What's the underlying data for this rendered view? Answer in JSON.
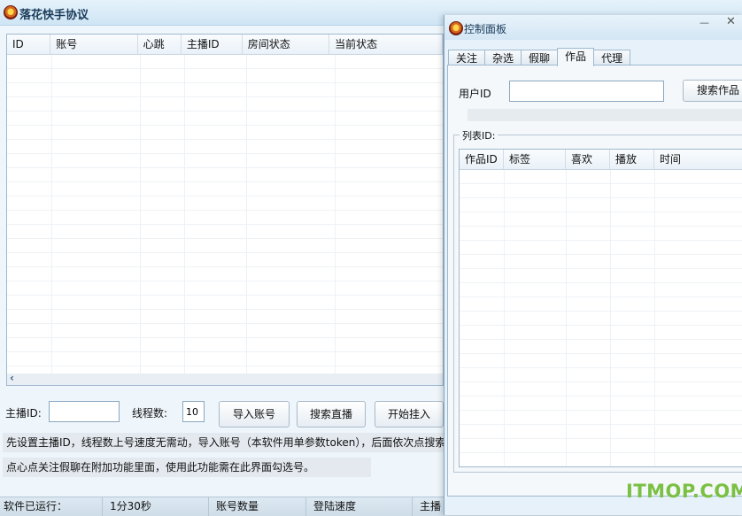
{
  "main_window": {
    "title": "落花快手协议",
    "table": {
      "columns": [
        "ID",
        "账号",
        "心跳",
        "主播ID",
        "房间状态",
        "当前状态"
      ],
      "rows": []
    },
    "anchor_id": {
      "label": "主播ID:",
      "value": ""
    },
    "threads": {
      "label": "线程数:",
      "value": "10"
    },
    "buttons": {
      "import": "导入账号",
      "search_live": "搜索直播",
      "start": "开始挂入"
    },
    "notice_line1": "先设置主播ID，线程数上号速度无需动，导入账号（本软件用单参数token），后面依次点搜索",
    "notice_line2": "点心点关注假聊在附加功能里面，使用此功能需在此界面勾选号。"
  },
  "statusbar": {
    "running_label": "软件已运行：",
    "running_value": "1分30秒",
    "account_count_label": "账号数量",
    "login_speed_label": "登陆速度",
    "anchor_label": "主播"
  },
  "control_panel": {
    "title": "控制面板",
    "tabs": [
      "关注",
      "杂选",
      "假聊",
      "作品",
      "代理"
    ],
    "active_tab": "作品",
    "user_id": {
      "label": "用户ID",
      "value": ""
    },
    "search_button": "搜索作品",
    "list_group_label": "列表ID:",
    "table": {
      "columns": [
        "作品ID",
        "标签",
        "喜欢",
        "播放",
        "时间"
      ],
      "rows": []
    }
  },
  "watermark": "ITMOP.COM"
}
